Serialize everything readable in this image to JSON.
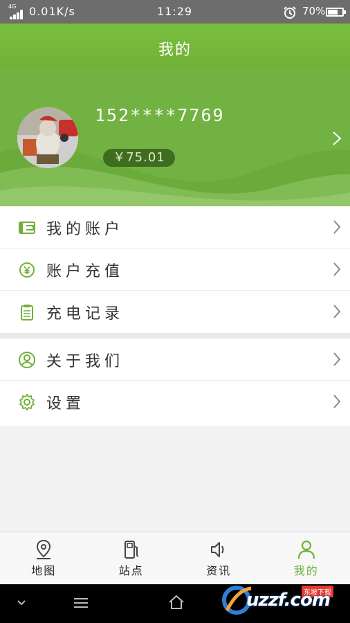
{
  "status_bar": {
    "network": "4G",
    "speed": "0.01K/s",
    "time": "11:29",
    "battery_text": "70%",
    "battery_level": 0.7
  },
  "header": {
    "title": "我的"
  },
  "profile": {
    "phone": "152****7769",
    "balance": "￥75.01"
  },
  "menu": [
    {
      "label": "我的账户",
      "icon": "wallet-icon"
    },
    {
      "label": "账户充值",
      "icon": "yen-icon"
    },
    {
      "label": "充电记录",
      "icon": "clipboard-icon"
    },
    {
      "label": "关于我们",
      "icon": "user-circle-icon"
    },
    {
      "label": "设置",
      "icon": "gear-icon"
    }
  ],
  "bottom_nav": [
    {
      "label": "地图",
      "icon": "map-pin-icon",
      "active": false
    },
    {
      "label": "站点",
      "icon": "fuel-station-icon",
      "active": false
    },
    {
      "label": "资讯",
      "icon": "speaker-icon",
      "active": false
    },
    {
      "label": "我的",
      "icon": "person-icon",
      "active": true
    }
  ],
  "watermark": {
    "text": "uzzf.com",
    "badge": "东坡下载"
  },
  "colors": {
    "accent": "#6fb136",
    "header": "#7bbf3f",
    "balance_pill": "#3e6d1f",
    "status_bar": "#6d6d6d"
  }
}
